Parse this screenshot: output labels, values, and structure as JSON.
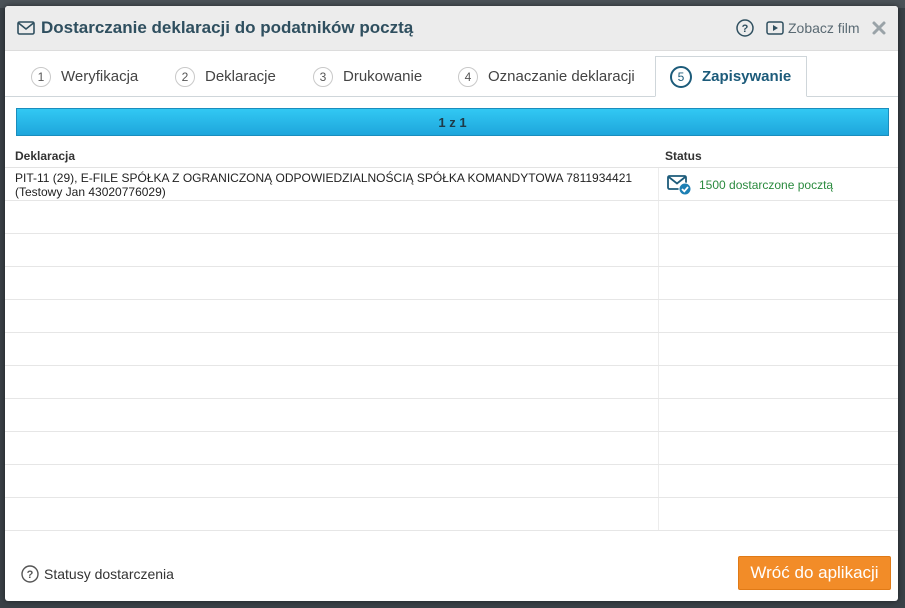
{
  "dialog": {
    "title": "Dostarczanie deklaracji do podatników pocztą",
    "film_label": "Zobacz film"
  },
  "tabs": [
    {
      "num": "1",
      "label": "Weryfikacja",
      "active": false
    },
    {
      "num": "2",
      "label": "Deklaracje",
      "active": false
    },
    {
      "num": "3",
      "label": "Drukowanie",
      "active": false
    },
    {
      "num": "4",
      "label": "Oznaczanie deklaracji",
      "active": false
    },
    {
      "num": "5",
      "label": "Zapisywanie",
      "active": true
    }
  ],
  "progress": {
    "text": "1 z 1",
    "fraction": 1.0
  },
  "table": {
    "headers": {
      "declaration": "Deklaracja",
      "status": "Status"
    },
    "rows": [
      {
        "declaration_line1": "PIT-11 (29), E-FILE SPÓŁKA Z OGRANICZONĄ ODPOWIEDZIALNOŚCIĄ SPÓŁKA KOMANDYTOWA 7811934421",
        "declaration_line2": "(Testowy Jan 43020776029)",
        "status": "1500 dostarczone pocztą",
        "status_icon": "mail-check-icon"
      }
    ],
    "empty_rows": 10
  },
  "footer": {
    "help_label": "Statusy dostarczenia",
    "back_label": "Wróć do aplikacji"
  },
  "colors": {
    "accent": "#1c5b7a",
    "progress": "#26b4e8",
    "status_ok": "#2a8a3e",
    "button": "#f28c28"
  }
}
